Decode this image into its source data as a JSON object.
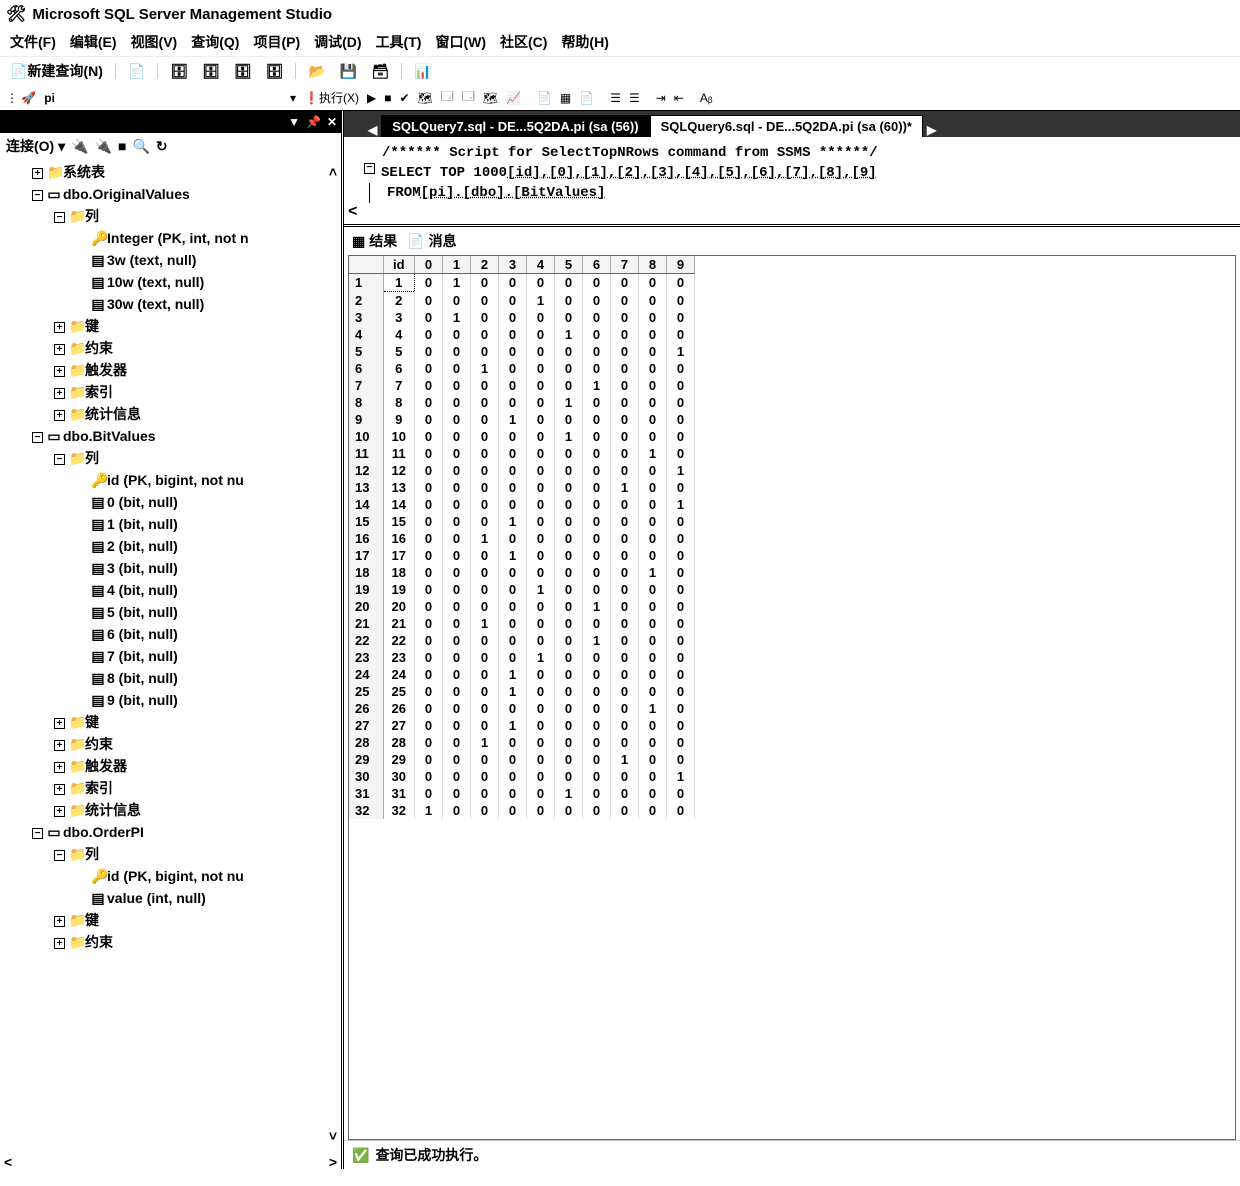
{
  "window": {
    "title": "Microsoft SQL Server Management Studio"
  },
  "menu": [
    "文件(F)",
    "编辑(E)",
    "视图(V)",
    "查询(Q)",
    "项目(P)",
    "调试(D)",
    "工具(T)",
    "窗口(W)",
    "社区(C)",
    "帮助(H)"
  ],
  "toolbar": {
    "new_query": "新建查询(N)"
  },
  "db_combo": {
    "value": "pi",
    "execute": "执行(X)"
  },
  "sidebar": {
    "connect_label": "连接(O)",
    "nodes": [
      {
        "d": 1,
        "pm": "+",
        "ic": "📁",
        "t": "系统表"
      },
      {
        "d": 1,
        "pm": "-",
        "ic": "▭",
        "t": "dbo.OriginalValues"
      },
      {
        "d": 2,
        "pm": "-",
        "ic": "📁",
        "t": "列"
      },
      {
        "d": 3,
        "pm": "",
        "ic": "🔑",
        "t": "Integer (PK, int, not n"
      },
      {
        "d": 3,
        "pm": "",
        "ic": "▤",
        "t": "3w (text, null)"
      },
      {
        "d": 3,
        "pm": "",
        "ic": "▤",
        "t": "10w (text, null)"
      },
      {
        "d": 3,
        "pm": "",
        "ic": "▤",
        "t": "30w (text, null)"
      },
      {
        "d": 2,
        "pm": "+",
        "ic": "📁",
        "t": "键"
      },
      {
        "d": 2,
        "pm": "+",
        "ic": "📁",
        "t": "约束"
      },
      {
        "d": 2,
        "pm": "+",
        "ic": "📁",
        "t": "触发器"
      },
      {
        "d": 2,
        "pm": "+",
        "ic": "📁",
        "t": "索引"
      },
      {
        "d": 2,
        "pm": "+",
        "ic": "📁",
        "t": "统计信息"
      },
      {
        "d": 1,
        "pm": "-",
        "ic": "▭",
        "t": "dbo.BitValues"
      },
      {
        "d": 2,
        "pm": "-",
        "ic": "📁",
        "t": "列"
      },
      {
        "d": 3,
        "pm": "",
        "ic": "🔑",
        "t": "id (PK, bigint, not nu"
      },
      {
        "d": 3,
        "pm": "",
        "ic": "▤",
        "t": "0 (bit, null)"
      },
      {
        "d": 3,
        "pm": "",
        "ic": "▤",
        "t": "1 (bit, null)"
      },
      {
        "d": 3,
        "pm": "",
        "ic": "▤",
        "t": "2 (bit, null)"
      },
      {
        "d": 3,
        "pm": "",
        "ic": "▤",
        "t": "3 (bit, null)"
      },
      {
        "d": 3,
        "pm": "",
        "ic": "▤",
        "t": "4 (bit, null)"
      },
      {
        "d": 3,
        "pm": "",
        "ic": "▤",
        "t": "5 (bit, null)"
      },
      {
        "d": 3,
        "pm": "",
        "ic": "▤",
        "t": "6 (bit, null)"
      },
      {
        "d": 3,
        "pm": "",
        "ic": "▤",
        "t": "7 (bit, null)"
      },
      {
        "d": 3,
        "pm": "",
        "ic": "▤",
        "t": "8 (bit, null)"
      },
      {
        "d": 3,
        "pm": "",
        "ic": "▤",
        "t": "9 (bit, null)"
      },
      {
        "d": 2,
        "pm": "+",
        "ic": "📁",
        "t": "键"
      },
      {
        "d": 2,
        "pm": "+",
        "ic": "📁",
        "t": "约束"
      },
      {
        "d": 2,
        "pm": "+",
        "ic": "📁",
        "t": "触发器"
      },
      {
        "d": 2,
        "pm": "+",
        "ic": "📁",
        "t": "索引"
      },
      {
        "d": 2,
        "pm": "+",
        "ic": "📁",
        "t": "统计信息"
      },
      {
        "d": 1,
        "pm": "-",
        "ic": "▭",
        "t": "dbo.OrderPI"
      },
      {
        "d": 2,
        "pm": "-",
        "ic": "📁",
        "t": "列"
      },
      {
        "d": 3,
        "pm": "",
        "ic": "🔑",
        "t": "id (PK, bigint, not nu"
      },
      {
        "d": 3,
        "pm": "",
        "ic": "▤",
        "t": "value (int, null)"
      },
      {
        "d": 2,
        "pm": "+",
        "ic": "📁",
        "t": "键"
      },
      {
        "d": 2,
        "pm": "+",
        "ic": "📁",
        "t": "约束"
      }
    ]
  },
  "tabs": [
    {
      "label": "SQLQuery7.sql - DE...5Q2DA.pi (sa (56))",
      "active": false
    },
    {
      "label": "SQLQuery6.sql - DE...5Q2DA.pi (sa (60))*",
      "active": true
    }
  ],
  "editor": {
    "line1": "/****** Script for SelectTopNRows command from SSMS  ******/",
    "line2_a": "SELECT TOP 1000 ",
    "line2_b": "[id],[0],[1],[2],[3],[4],[5],[6],[7],[8],[9]",
    "line3_a": "FROM ",
    "line3_b": "[pi].[dbo].[BitValues]"
  },
  "result_tabs": {
    "results": "结果",
    "messages": "消息"
  },
  "grid": {
    "columns": [
      "",
      "id",
      "0",
      "1",
      "2",
      "3",
      "4",
      "5",
      "6",
      "7",
      "8",
      "9"
    ],
    "rows": [
      [
        1,
        1,
        0,
        1,
        0,
        0,
        0,
        0,
        0,
        0,
        0,
        0
      ],
      [
        2,
        2,
        0,
        0,
        0,
        0,
        1,
        0,
        0,
        0,
        0,
        0
      ],
      [
        3,
        3,
        0,
        1,
        0,
        0,
        0,
        0,
        0,
        0,
        0,
        0
      ],
      [
        4,
        4,
        0,
        0,
        0,
        0,
        0,
        1,
        0,
        0,
        0,
        0
      ],
      [
        5,
        5,
        0,
        0,
        0,
        0,
        0,
        0,
        0,
        0,
        0,
        1
      ],
      [
        6,
        6,
        0,
        0,
        1,
        0,
        0,
        0,
        0,
        0,
        0,
        0
      ],
      [
        7,
        7,
        0,
        0,
        0,
        0,
        0,
        0,
        1,
        0,
        0,
        0
      ],
      [
        8,
        8,
        0,
        0,
        0,
        0,
        0,
        1,
        0,
        0,
        0,
        0
      ],
      [
        9,
        9,
        0,
        0,
        0,
        1,
        0,
        0,
        0,
        0,
        0,
        0
      ],
      [
        10,
        10,
        0,
        0,
        0,
        0,
        0,
        1,
        0,
        0,
        0,
        0
      ],
      [
        11,
        11,
        0,
        0,
        0,
        0,
        0,
        0,
        0,
        0,
        1,
        0
      ],
      [
        12,
        12,
        0,
        0,
        0,
        0,
        0,
        0,
        0,
        0,
        0,
        1
      ],
      [
        13,
        13,
        0,
        0,
        0,
        0,
        0,
        0,
        0,
        1,
        0,
        0
      ],
      [
        14,
        14,
        0,
        0,
        0,
        0,
        0,
        0,
        0,
        0,
        0,
        1
      ],
      [
        15,
        15,
        0,
        0,
        0,
        1,
        0,
        0,
        0,
        0,
        0,
        0
      ],
      [
        16,
        16,
        0,
        0,
        1,
        0,
        0,
        0,
        0,
        0,
        0,
        0
      ],
      [
        17,
        17,
        0,
        0,
        0,
        1,
        0,
        0,
        0,
        0,
        0,
        0
      ],
      [
        18,
        18,
        0,
        0,
        0,
        0,
        0,
        0,
        0,
        0,
        1,
        0
      ],
      [
        19,
        19,
        0,
        0,
        0,
        0,
        1,
        0,
        0,
        0,
        0,
        0
      ],
      [
        20,
        20,
        0,
        0,
        0,
        0,
        0,
        0,
        1,
        0,
        0,
        0
      ],
      [
        21,
        21,
        0,
        0,
        1,
        0,
        0,
        0,
        0,
        0,
        0,
        0
      ],
      [
        22,
        22,
        0,
        0,
        0,
        0,
        0,
        0,
        1,
        0,
        0,
        0
      ],
      [
        23,
        23,
        0,
        0,
        0,
        0,
        1,
        0,
        0,
        0,
        0,
        0
      ],
      [
        24,
        24,
        0,
        0,
        0,
        1,
        0,
        0,
        0,
        0,
        0,
        0
      ],
      [
        25,
        25,
        0,
        0,
        0,
        1,
        0,
        0,
        0,
        0,
        0,
        0
      ],
      [
        26,
        26,
        0,
        0,
        0,
        0,
        0,
        0,
        0,
        0,
        1,
        0
      ],
      [
        27,
        27,
        0,
        0,
        0,
        1,
        0,
        0,
        0,
        0,
        0,
        0
      ],
      [
        28,
        28,
        0,
        0,
        1,
        0,
        0,
        0,
        0,
        0,
        0,
        0
      ],
      [
        29,
        29,
        0,
        0,
        0,
        0,
        0,
        0,
        0,
        1,
        0,
        0
      ],
      [
        30,
        30,
        0,
        0,
        0,
        0,
        0,
        0,
        0,
        0,
        0,
        1
      ],
      [
        31,
        31,
        0,
        0,
        0,
        0,
        0,
        1,
        0,
        0,
        0,
        0
      ],
      [
        32,
        32,
        1,
        0,
        0,
        0,
        0,
        0,
        0,
        0,
        0,
        0
      ]
    ]
  },
  "status": {
    "text": "查询已成功执行。"
  }
}
